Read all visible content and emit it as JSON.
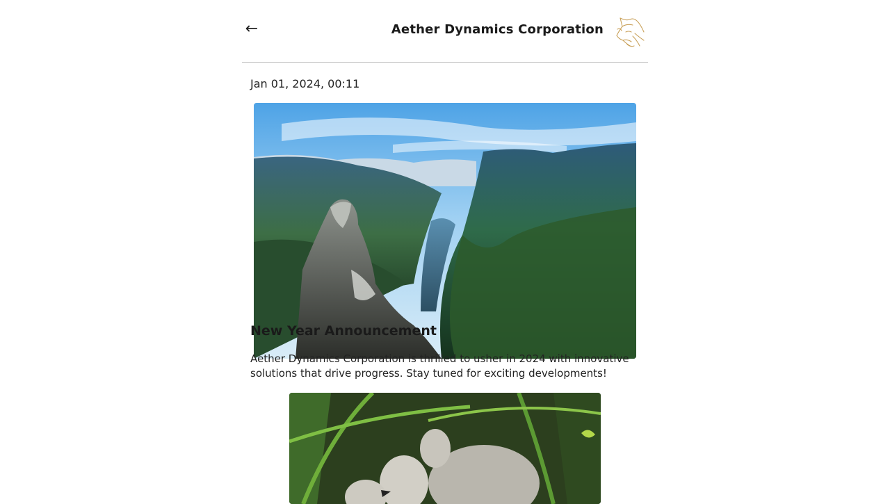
{
  "header": {
    "back_glyph": "←",
    "company_name": "Aether Dynamics Corporation",
    "logo_icon": "cat-logo-icon",
    "accent_color": "#c9a15a"
  },
  "post": {
    "date": "Jan 01, 2024, 00:11",
    "hero_image": "fjord-mountain-landscape",
    "title": "New Year Announcement",
    "body": "Aether Dynamics Corporation is thrilled to usher in 2024 with innovative solutions that drive progress. Stay tuned for exciting developments!"
  },
  "next_post": {
    "image": "cygnets-in-grass"
  }
}
